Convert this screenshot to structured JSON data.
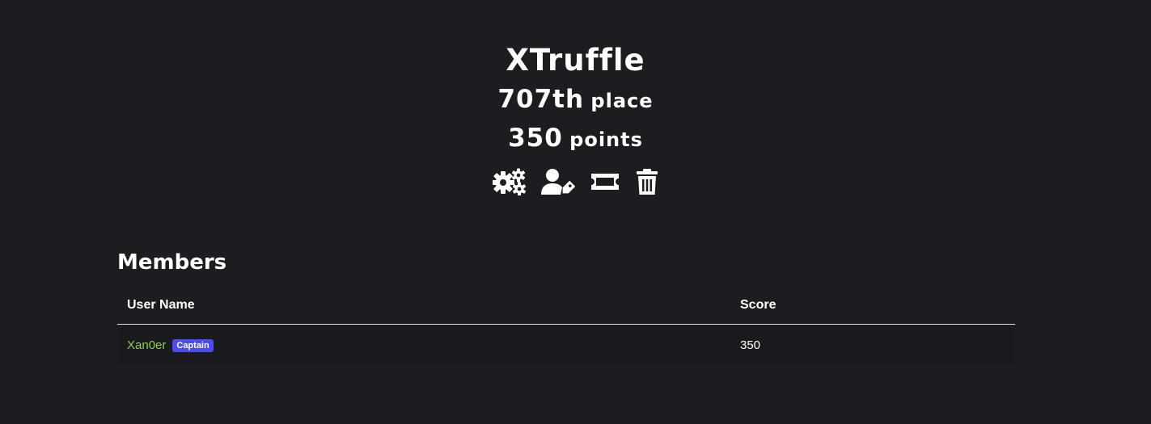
{
  "team": {
    "name": "XTruffle",
    "place_number": "707th",
    "place_label": "place",
    "points_number": "350",
    "points_label": "points"
  },
  "actions": [
    {
      "icon": "gears-icon"
    },
    {
      "icon": "user-tag-icon"
    },
    {
      "icon": "ticket-icon"
    },
    {
      "icon": "trash-icon"
    }
  ],
  "members": {
    "title": "Members",
    "columns": {
      "user": "User Name",
      "score": "Score"
    },
    "rows": [
      {
        "name": "Xan0er",
        "badge": "Captain",
        "score": "350"
      }
    ]
  },
  "colors": {
    "background": "#1c1d21",
    "username_link": "#8fd14f",
    "badge": "#4b4bf0"
  }
}
